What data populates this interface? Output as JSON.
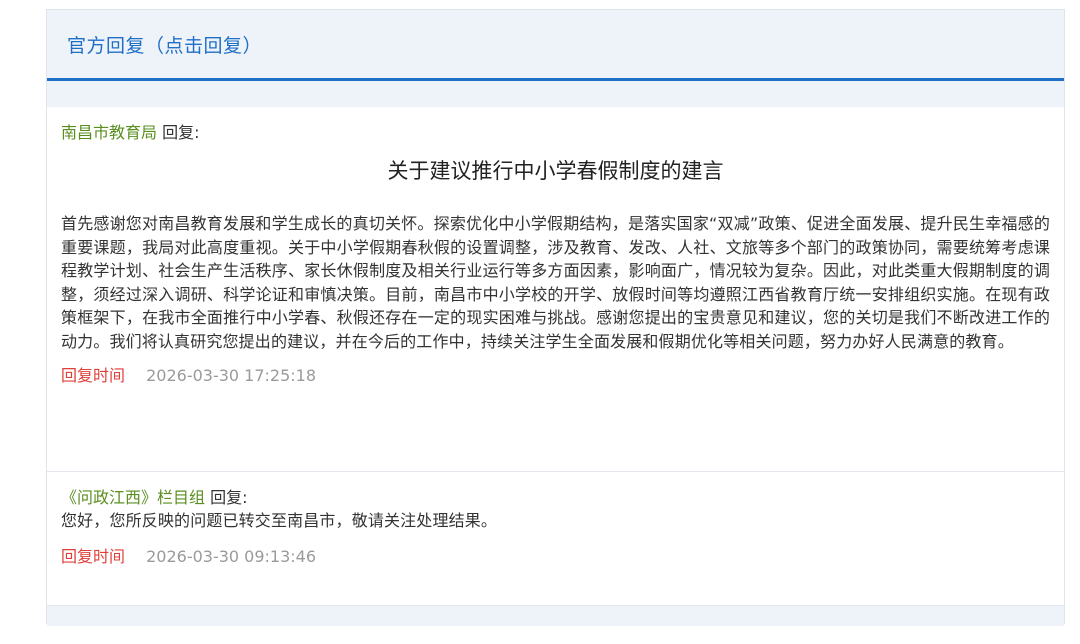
{
  "header": {
    "title": "官方回复（点击回复）"
  },
  "replies": [
    {
      "replier": "南昌市教育局",
      "reply_suffix": "回复:",
      "title": "关于建议推行中小学春假制度的建言",
      "body": "首先感谢您对南昌教育发展和学生成长的真切关怀。探索优化中小学假期结构，是落实国家“双减”政策、促进全面发展、提升民生幸福感的重要课题，我局对此高度重视。关于中小学假期春秋假的设置调整，涉及教育、发改、人社、文旅等多个部门的政策协同，需要统筹考虑课程教学计划、社会生产生活秩序、家长休假制度及相关行业运行等多方面因素，影响面广，情况较为复杂。因此，对此类重大假期制度的调整，须经过深入调研、科学论证和审慎决策。目前，南昌市中小学校的开学、放假时间等均遵照江西省教育厅统一安排组织实施。在现有政策框架下，在我市全面推行中小学春、秋假还存在一定的现实困难与挑战。感谢您提出的宝贵意见和建议，您的关切是我们不断改进工作的动力。我们将认真研究您提出的建议，并在今后的工作中，持续关注学生全面发展和假期优化等相关问题，努力办好人民满意的教育。",
      "time_label": "回复时间",
      "time_value": "2026-03-30 17:25:18"
    },
    {
      "replier": "《问政江西》栏目组",
      "reply_suffix": "回复:",
      "body": "您好，您所反映的问题已转交至南昌市，敬请关注处理结果。",
      "time_label": "回复时间",
      "time_value": "2026-03-30 09:13:46"
    }
  ],
  "colors": {
    "accent": "#1f6fc6",
    "replier": "#5a8e1f",
    "time_label": "#e0403a",
    "time_value": "#9a9a9a",
    "band": "#eef3fa"
  }
}
